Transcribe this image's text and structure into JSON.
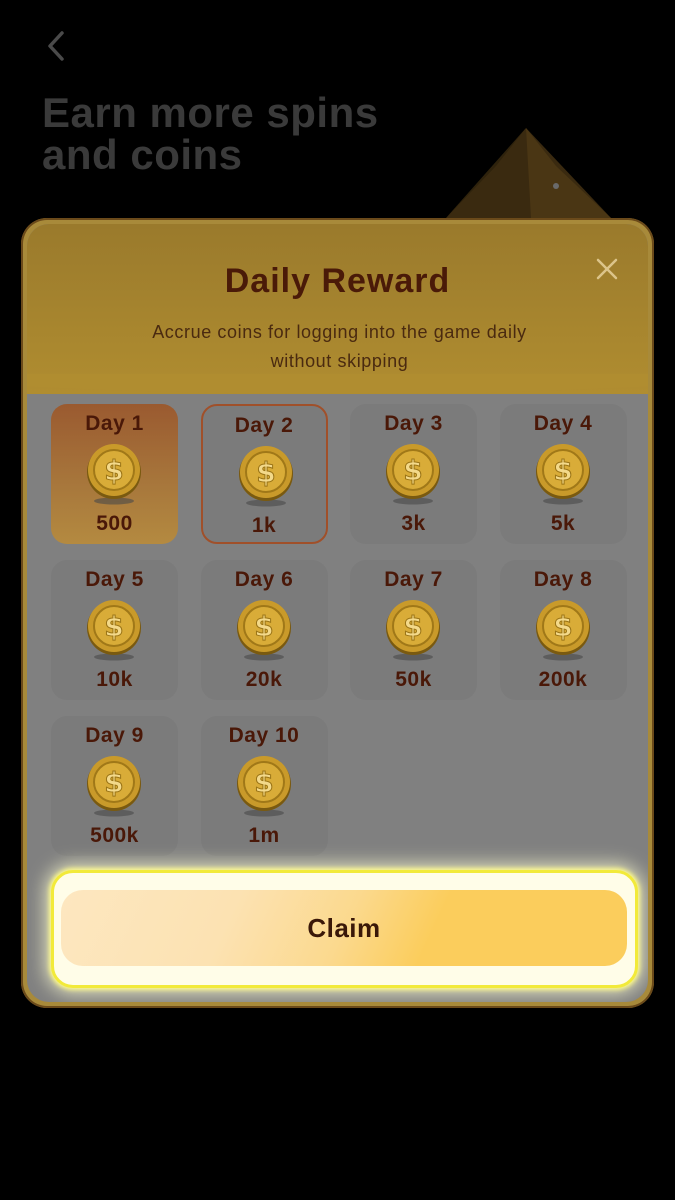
{
  "background": {
    "title": "Earn more spins and coins",
    "back_icon": "chevron-left-icon"
  },
  "modal": {
    "title": "Daily Reward",
    "subtitle": "Accrue coins for logging into the game daily without skipping",
    "close_icon": "close-icon",
    "claim_label": "Claim",
    "rewards": [
      {
        "day": "Day 1",
        "amount": "500",
        "state": "current"
      },
      {
        "day": "Day 2",
        "amount": "1k",
        "state": "next"
      },
      {
        "day": "Day 3",
        "amount": "3k",
        "state": "locked"
      },
      {
        "day": "Day 4",
        "amount": "5k",
        "state": "locked"
      },
      {
        "day": "Day 5",
        "amount": "10k",
        "state": "locked"
      },
      {
        "day": "Day 6",
        "amount": "20k",
        "state": "locked"
      },
      {
        "day": "Day 7",
        "amount": "50k",
        "state": "locked"
      },
      {
        "day": "Day 8",
        "amount": "200k",
        "state": "locked"
      },
      {
        "day": "Day 9",
        "amount": "500k",
        "state": "locked"
      },
      {
        "day": "Day 10",
        "amount": "1m",
        "state": "locked"
      }
    ]
  },
  "colors": {
    "modal_border": "#a88a3a",
    "header": "#b08d30",
    "text_dark": "#4a1808",
    "claim_highlight": "#f2ea3a",
    "claim_fill": "#fbcd5c"
  }
}
